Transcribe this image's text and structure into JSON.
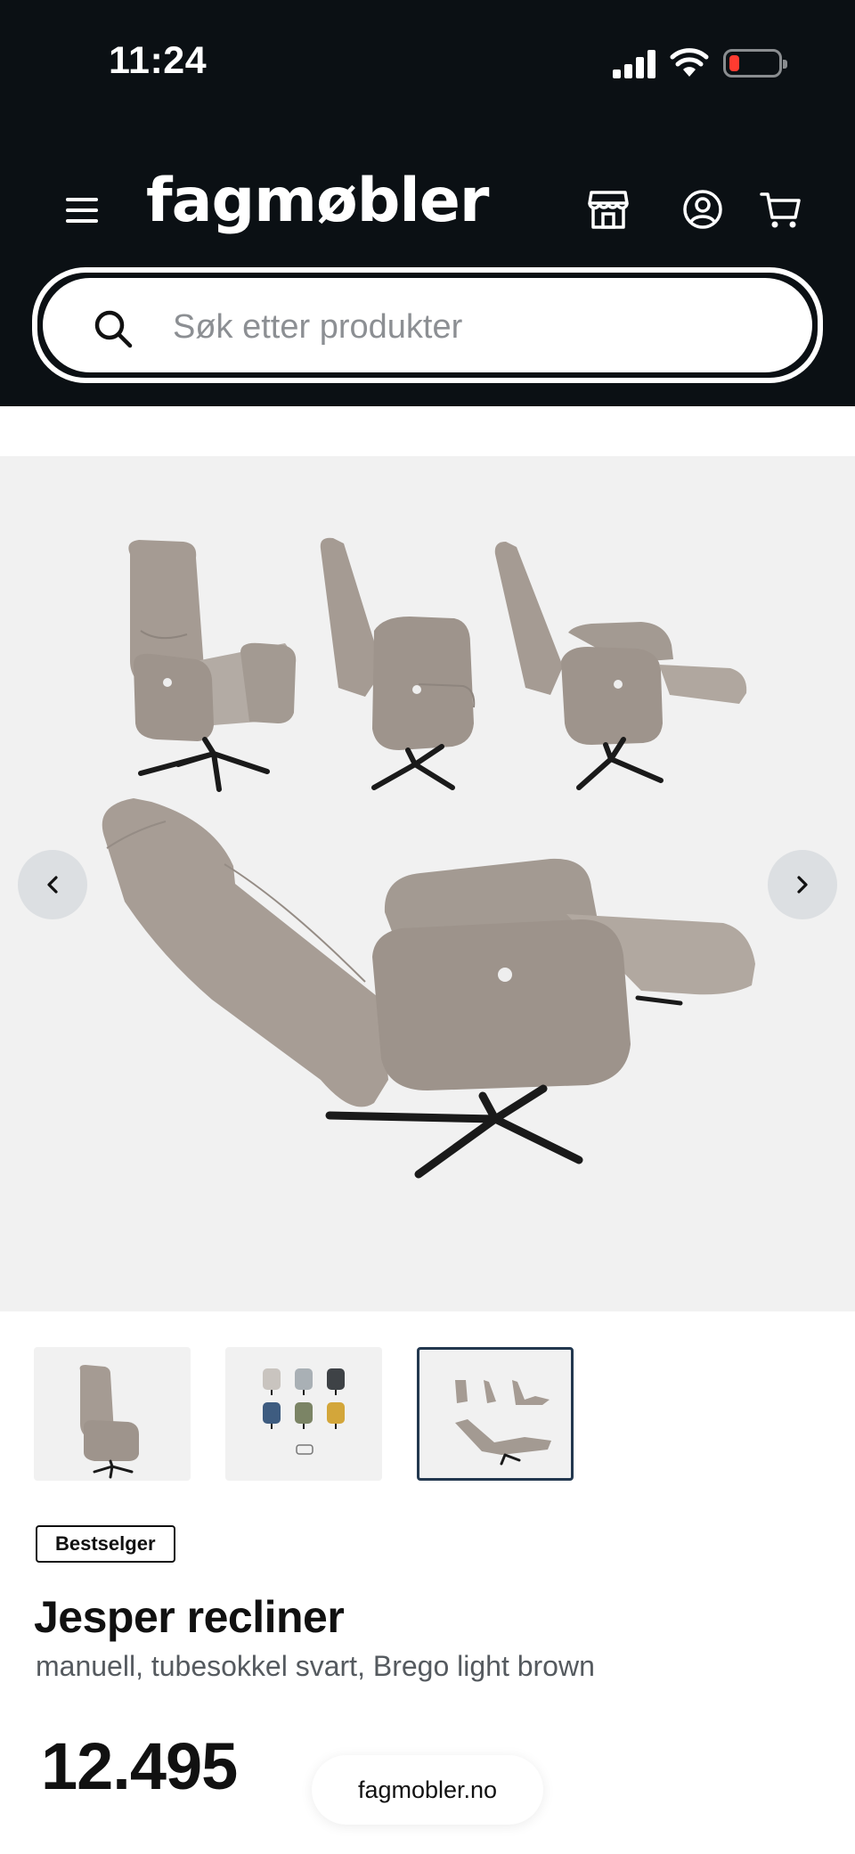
{
  "status_bar": {
    "time": "11:24"
  },
  "header": {
    "logo": "fagmøbler",
    "icons": [
      "menu-icon",
      "store-icon",
      "account-icon",
      "cart-icon"
    ]
  },
  "search": {
    "placeholder": "Søk etter produkter"
  },
  "gallery": {
    "thumbnails": [
      "chair-front-thumbnail",
      "color-options-thumbnail",
      "recline-positions-thumbnail"
    ],
    "active_index": 2
  },
  "product": {
    "badge": "Bestselger",
    "title": "Jesper recliner",
    "subtitle": "manuell, tubesokkel svart, Brego light brown",
    "price": "12.495"
  },
  "domain_pill": "fagmobler.no",
  "colors": {
    "header_bg": "#0b1014",
    "gallery_bg": "#f1f1f1",
    "active_thumb_border": "#23384f",
    "chair_fabric": "#a79d95",
    "chair_base": "#1a1a1a"
  }
}
